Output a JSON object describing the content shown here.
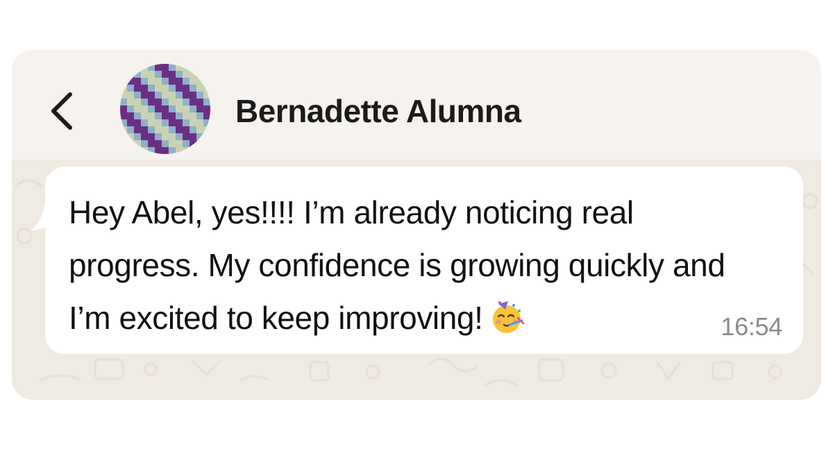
{
  "header": {
    "back_icon": "chevron-left-icon",
    "avatar_icon": "pixel-stripes-avatar",
    "contact_name": "Bernadette Alumna"
  },
  "message": {
    "text": "Hey Abel, yes!!!! I’m already noticing real progress. My confidence is growing quickly and I’m excited to keep improving!",
    "emoji_icon": "partying-face-icon",
    "time": "16:54"
  },
  "colors": {
    "chat_background": "#efeae2",
    "header_background": "#f5f2ef",
    "bubble_background": "#ffffff",
    "text": "#111111",
    "time_text": "#8b8b8b",
    "avatar_purple": "#6a2f85",
    "avatar_green": "#c9d3b4",
    "avatar_blue": "#8fb0c9"
  }
}
